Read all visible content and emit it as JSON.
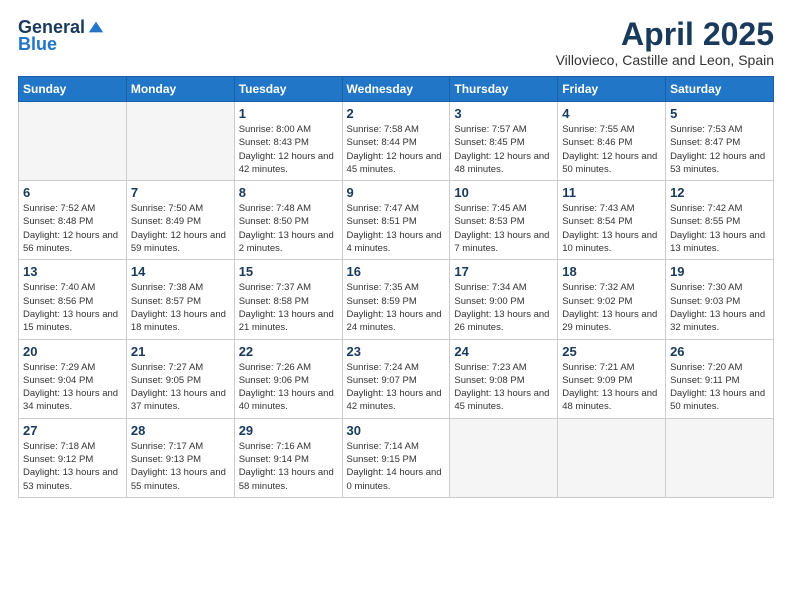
{
  "header": {
    "logo_general": "General",
    "logo_blue": "Blue",
    "title": "April 2025",
    "subtitle": "Villovieco, Castille and Leon, Spain"
  },
  "weekdays": [
    "Sunday",
    "Monday",
    "Tuesday",
    "Wednesday",
    "Thursday",
    "Friday",
    "Saturday"
  ],
  "weeks": [
    [
      {
        "day": "",
        "info": ""
      },
      {
        "day": "",
        "info": ""
      },
      {
        "day": "1",
        "info": "Sunrise: 8:00 AM\nSunset: 8:43 PM\nDaylight: 12 hours and 42 minutes."
      },
      {
        "day": "2",
        "info": "Sunrise: 7:58 AM\nSunset: 8:44 PM\nDaylight: 12 hours and 45 minutes."
      },
      {
        "day": "3",
        "info": "Sunrise: 7:57 AM\nSunset: 8:45 PM\nDaylight: 12 hours and 48 minutes."
      },
      {
        "day": "4",
        "info": "Sunrise: 7:55 AM\nSunset: 8:46 PM\nDaylight: 12 hours and 50 minutes."
      },
      {
        "day": "5",
        "info": "Sunrise: 7:53 AM\nSunset: 8:47 PM\nDaylight: 12 hours and 53 minutes."
      }
    ],
    [
      {
        "day": "6",
        "info": "Sunrise: 7:52 AM\nSunset: 8:48 PM\nDaylight: 12 hours and 56 minutes."
      },
      {
        "day": "7",
        "info": "Sunrise: 7:50 AM\nSunset: 8:49 PM\nDaylight: 12 hours and 59 minutes."
      },
      {
        "day": "8",
        "info": "Sunrise: 7:48 AM\nSunset: 8:50 PM\nDaylight: 13 hours and 2 minutes."
      },
      {
        "day": "9",
        "info": "Sunrise: 7:47 AM\nSunset: 8:51 PM\nDaylight: 13 hours and 4 minutes."
      },
      {
        "day": "10",
        "info": "Sunrise: 7:45 AM\nSunset: 8:53 PM\nDaylight: 13 hours and 7 minutes."
      },
      {
        "day": "11",
        "info": "Sunrise: 7:43 AM\nSunset: 8:54 PM\nDaylight: 13 hours and 10 minutes."
      },
      {
        "day": "12",
        "info": "Sunrise: 7:42 AM\nSunset: 8:55 PM\nDaylight: 13 hours and 13 minutes."
      }
    ],
    [
      {
        "day": "13",
        "info": "Sunrise: 7:40 AM\nSunset: 8:56 PM\nDaylight: 13 hours and 15 minutes."
      },
      {
        "day": "14",
        "info": "Sunrise: 7:38 AM\nSunset: 8:57 PM\nDaylight: 13 hours and 18 minutes."
      },
      {
        "day": "15",
        "info": "Sunrise: 7:37 AM\nSunset: 8:58 PM\nDaylight: 13 hours and 21 minutes."
      },
      {
        "day": "16",
        "info": "Sunrise: 7:35 AM\nSunset: 8:59 PM\nDaylight: 13 hours and 24 minutes."
      },
      {
        "day": "17",
        "info": "Sunrise: 7:34 AM\nSunset: 9:00 PM\nDaylight: 13 hours and 26 minutes."
      },
      {
        "day": "18",
        "info": "Sunrise: 7:32 AM\nSunset: 9:02 PM\nDaylight: 13 hours and 29 minutes."
      },
      {
        "day": "19",
        "info": "Sunrise: 7:30 AM\nSunset: 9:03 PM\nDaylight: 13 hours and 32 minutes."
      }
    ],
    [
      {
        "day": "20",
        "info": "Sunrise: 7:29 AM\nSunset: 9:04 PM\nDaylight: 13 hours and 34 minutes."
      },
      {
        "day": "21",
        "info": "Sunrise: 7:27 AM\nSunset: 9:05 PM\nDaylight: 13 hours and 37 minutes."
      },
      {
        "day": "22",
        "info": "Sunrise: 7:26 AM\nSunset: 9:06 PM\nDaylight: 13 hours and 40 minutes."
      },
      {
        "day": "23",
        "info": "Sunrise: 7:24 AM\nSunset: 9:07 PM\nDaylight: 13 hours and 42 minutes."
      },
      {
        "day": "24",
        "info": "Sunrise: 7:23 AM\nSunset: 9:08 PM\nDaylight: 13 hours and 45 minutes."
      },
      {
        "day": "25",
        "info": "Sunrise: 7:21 AM\nSunset: 9:09 PM\nDaylight: 13 hours and 48 minutes."
      },
      {
        "day": "26",
        "info": "Sunrise: 7:20 AM\nSunset: 9:11 PM\nDaylight: 13 hours and 50 minutes."
      }
    ],
    [
      {
        "day": "27",
        "info": "Sunrise: 7:18 AM\nSunset: 9:12 PM\nDaylight: 13 hours and 53 minutes."
      },
      {
        "day": "28",
        "info": "Sunrise: 7:17 AM\nSunset: 9:13 PM\nDaylight: 13 hours and 55 minutes."
      },
      {
        "day": "29",
        "info": "Sunrise: 7:16 AM\nSunset: 9:14 PM\nDaylight: 13 hours and 58 minutes."
      },
      {
        "day": "30",
        "info": "Sunrise: 7:14 AM\nSunset: 9:15 PM\nDaylight: 14 hours and 0 minutes."
      },
      {
        "day": "",
        "info": ""
      },
      {
        "day": "",
        "info": ""
      },
      {
        "day": "",
        "info": ""
      }
    ]
  ]
}
